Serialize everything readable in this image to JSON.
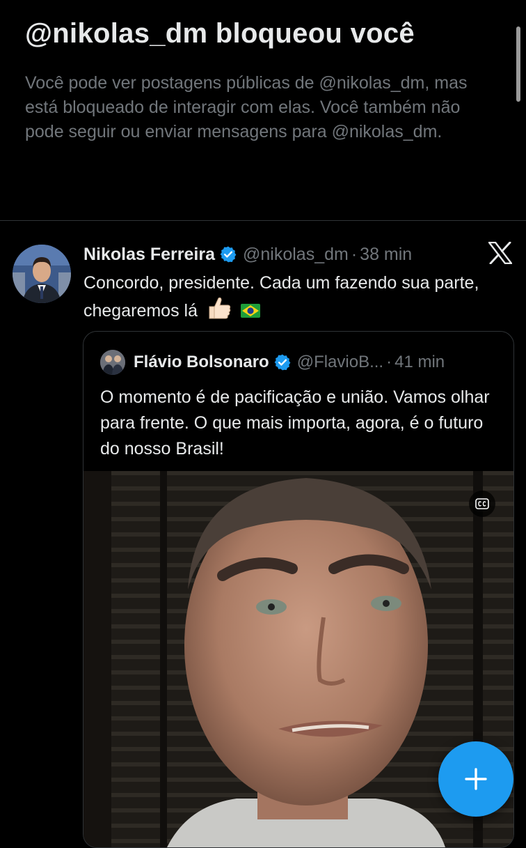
{
  "blocked": {
    "title": "@nikolas_dm bloqueou você",
    "description": "Você pode ver postagens públicas de @nikolas_dm, mas está bloqueado de interagir com elas. Você também não pode seguir ou enviar mensagens para @nikolas_dm."
  },
  "tweet": {
    "name": "Nikolas Ferreira",
    "handle": "@nikolas_dm",
    "separator": "·",
    "time": "38 min",
    "text": "Concordo, presidente. Cada um fazendo sua parte, chegaremos lá",
    "emojis": [
      "thumbs-up",
      "brazil-flag"
    ]
  },
  "quote": {
    "name": "Flávio Bolsonaro",
    "handle": "@FlavioB...",
    "separator": "·",
    "time": "41 min",
    "text": "O momento é de pacificação e união. Vamos olhar para frente. O que mais importa, agora, é o futuro do nosso Brasil!"
  },
  "media": {
    "cc_label": "cc"
  },
  "colors": {
    "accent": "#1d9bf0",
    "background": "#000000",
    "muted": "#71767b",
    "text": "#e7e9ea",
    "border": "#2f3336"
  },
  "icons": [
    "verified-badge-icon",
    "x-logo-icon",
    "closed-captions-icon",
    "plus-icon"
  ]
}
